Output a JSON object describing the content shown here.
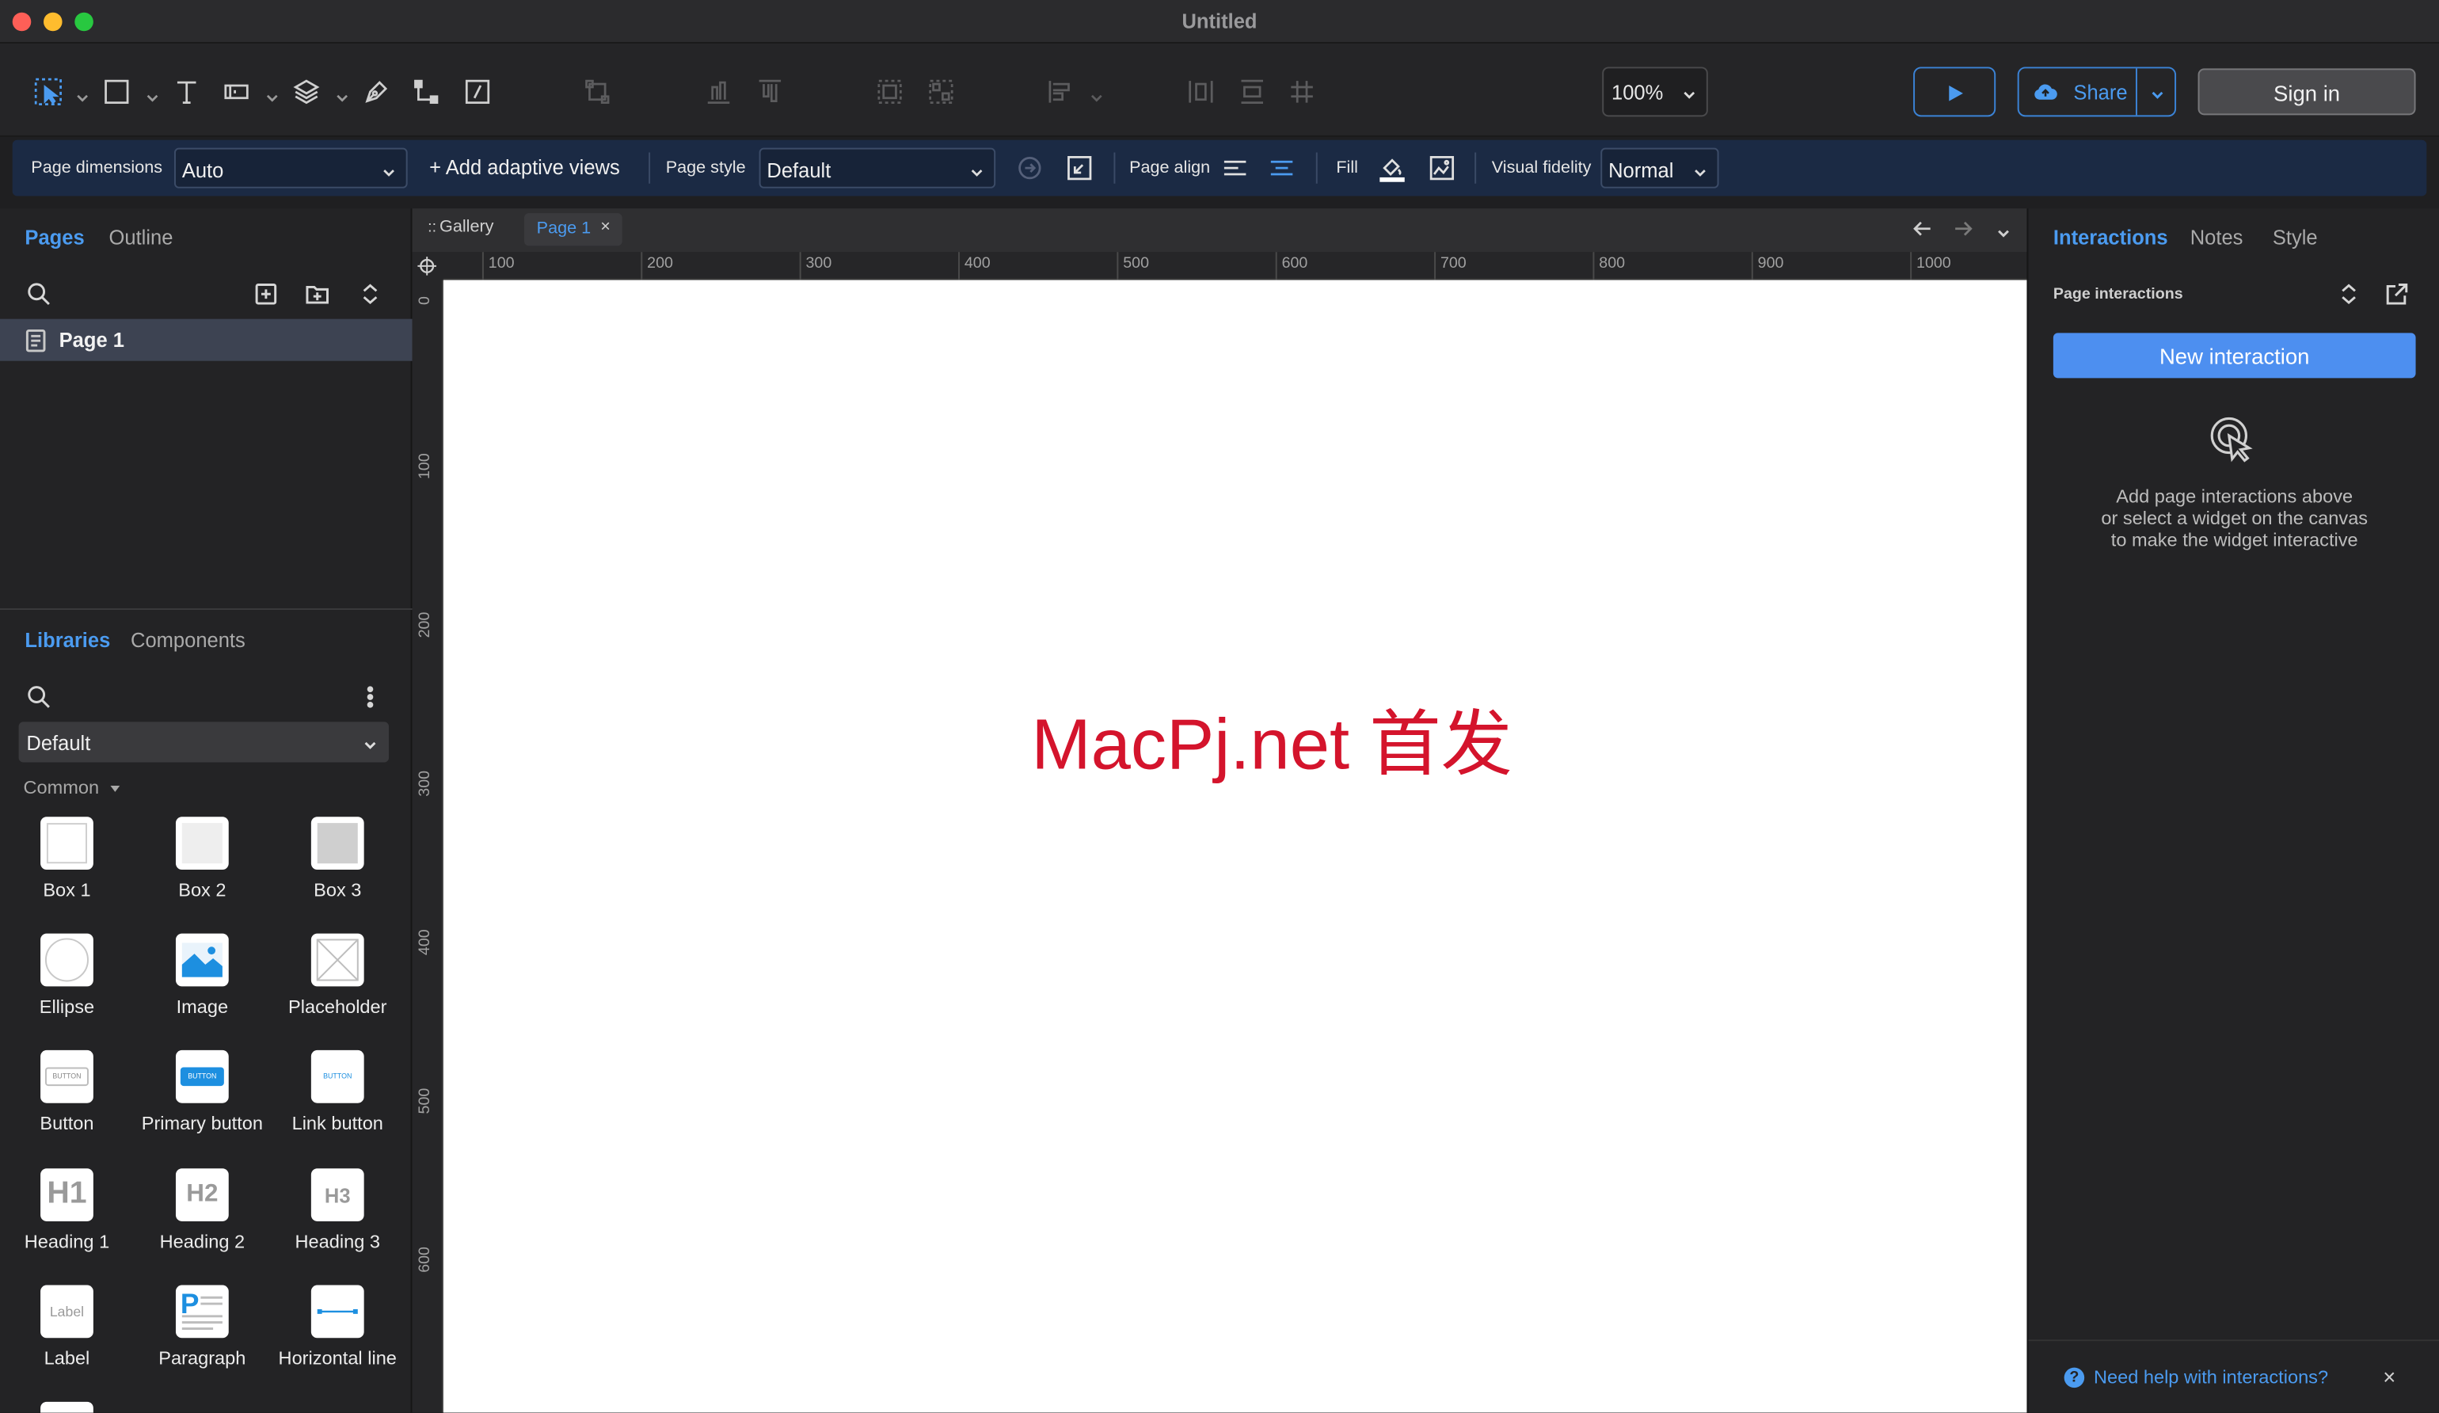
{
  "window": {
    "title": "Untitled"
  },
  "toolbar": {
    "zoom": "100%",
    "share_label": "Share",
    "signin_label": "Sign in"
  },
  "props": {
    "page_dimensions_label": "Page dimensions",
    "page_dimensions_value": "Auto",
    "add_adaptive": "+ Add adaptive views",
    "page_style_label": "Page style",
    "page_style_value": "Default",
    "page_align_label": "Page align",
    "fill_label": "Fill",
    "visual_fidelity_label": "Visual fidelity",
    "visual_fidelity_value": "Normal"
  },
  "left": {
    "tabs": [
      "Pages",
      "Outline"
    ],
    "pages": [
      {
        "label": "Page 1"
      }
    ],
    "lib_tabs": [
      "Libraries",
      "Components"
    ],
    "library_selected": "Default",
    "group_label": "Common",
    "widgets": [
      {
        "label": "Box 1",
        "icon": "box1-icon"
      },
      {
        "label": "Box 2",
        "icon": "box2-icon"
      },
      {
        "label": "Box 3",
        "icon": "box3-icon"
      },
      {
        "label": "Ellipse",
        "icon": "ellipse-icon"
      },
      {
        "label": "Image",
        "icon": "image-icon"
      },
      {
        "label": "Placeholder",
        "icon": "placeholder-icon"
      },
      {
        "label": "Button",
        "icon": "button-icon"
      },
      {
        "label": "Primary button",
        "icon": "primary-button-icon"
      },
      {
        "label": "Link button",
        "icon": "link-button-icon"
      },
      {
        "label": "Heading 1",
        "icon": "heading1-icon"
      },
      {
        "label": "Heading 2",
        "icon": "heading2-icon"
      },
      {
        "label": "Heading 3",
        "icon": "heading3-icon"
      },
      {
        "label": "Label",
        "icon": "label-icon"
      },
      {
        "label": "Paragraph",
        "icon": "paragraph-icon"
      },
      {
        "label": "Horizontal line",
        "icon": "horizontal-line-icon"
      }
    ],
    "thumb_text": {
      "button": "BUTTON",
      "h1": "H1",
      "h2": "H2",
      "h3": "H3",
      "label": "Label",
      "paragraph": "P"
    }
  },
  "canvas": {
    "tabs": [
      {
        "label": "Gallery"
      },
      {
        "label": "Page 1"
      }
    ],
    "ruler_h": [
      "100",
      "200",
      "300",
      "400",
      "500",
      "600",
      "700",
      "800",
      "900",
      "1000"
    ],
    "ruler_v": [
      "0",
      "100",
      "200",
      "300",
      "400",
      "500",
      "600"
    ],
    "watermark": "MacPj.net 首发"
  },
  "right": {
    "tabs": [
      "Interactions",
      "Notes",
      "Style"
    ],
    "section_label": "Page interactions",
    "new_interaction": "New interaction",
    "help_lines": [
      "Add page interactions above",
      "or select a widget on the canvas",
      "to make the widget interactive"
    ],
    "help_link": "Need help with interactions?"
  },
  "colors": {
    "accent": "#4b9bf0",
    "watermark": "#d4142c",
    "propbar": "#1b2a44"
  }
}
